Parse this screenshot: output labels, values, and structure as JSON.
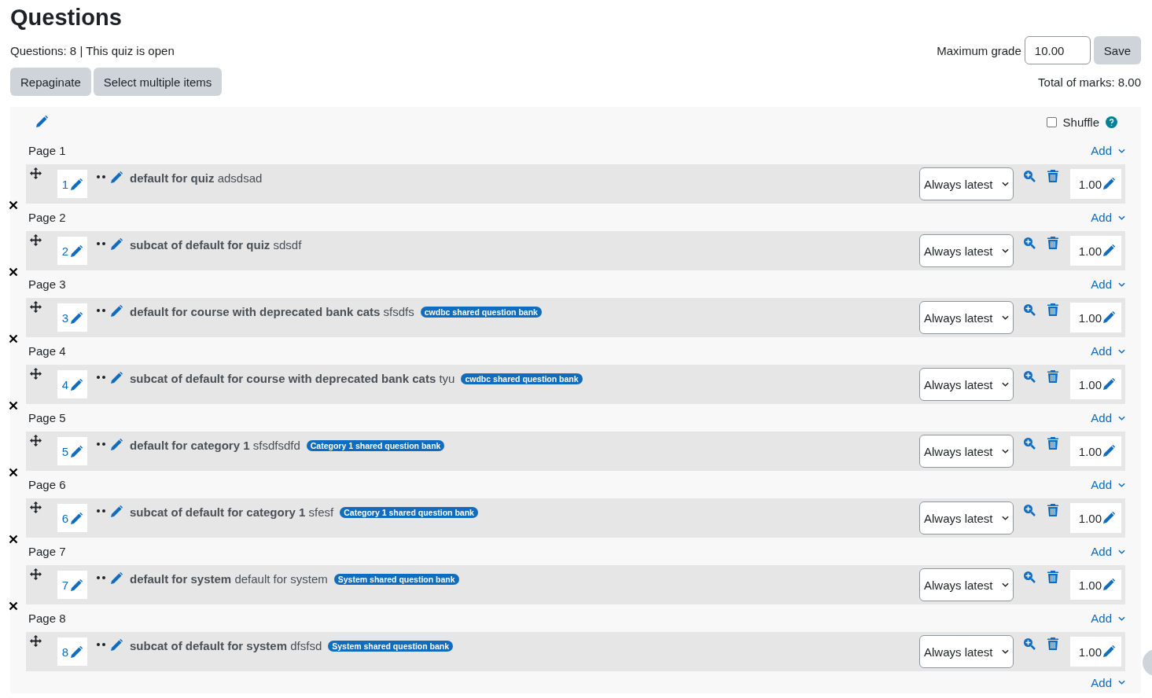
{
  "heading": "Questions",
  "summary": "Questions: 8 | This quiz is open",
  "buttons": [
    "Repaginate",
    "Select multiple items"
  ],
  "max_grade": {
    "label": "Maximum grade",
    "value": "10.00",
    "button": "Save"
  },
  "total_marks": "Total of marks: 8.00",
  "shuffle": {
    "label": "Shuffle",
    "checked": false
  },
  "pages": [
    {
      "label": "Page 1",
      "add": "Add",
      "question": {
        "number": "1",
        "name": "default for quiz",
        "text": "adsdsad",
        "version": "Always latest",
        "mark": "1.00"
      }
    },
    {
      "label": "Page 2",
      "add": "Add",
      "question": {
        "number": "2",
        "name": "subcat of default for quiz",
        "text": "sdsdf",
        "version": "Always latest",
        "mark": "1.00"
      }
    },
    {
      "label": "Page 3",
      "add": "Add",
      "question": {
        "number": "3",
        "name": "default for course with deprecated bank cats",
        "text": "sfsdfs",
        "badge": "cwdbc shared question bank",
        "version": "Always latest",
        "mark": "1.00"
      }
    },
    {
      "label": "Page 4",
      "add": "Add",
      "question": {
        "number": "4",
        "name": "subcat of default for course with deprecated bank cats",
        "text": "tyu",
        "badge": "cwdbc shared question bank",
        "version": "Always latest",
        "mark": "1.00"
      }
    },
    {
      "label": "Page 5",
      "add": "Add",
      "question": {
        "number": "5",
        "name": "default for category 1",
        "text": "sfsdfsdfd",
        "badge": "Category 1 shared question bank",
        "version": "Always latest",
        "mark": "1.00"
      }
    },
    {
      "label": "Page 6",
      "add": "Add",
      "question": {
        "number": "6",
        "name": "subcat of default for category 1",
        "text": "sfesf",
        "badge": "Category 1 shared question bank",
        "version": "Always latest",
        "mark": "1.00"
      }
    },
    {
      "label": "Page 7",
      "add": "Add",
      "question": {
        "number": "7",
        "name": "default for system",
        "text": "default for system",
        "badge": "System shared question bank",
        "version": "Always latest",
        "mark": "1.00"
      }
    },
    {
      "label": "Page 8",
      "add": "Add",
      "question": {
        "number": "8",
        "name": "subcat of default for system",
        "text": "dfsfsd",
        "badge": "System shared question bank",
        "version": "Always latest",
        "mark": "1.00"
      }
    }
  ],
  "final_add": "Add"
}
